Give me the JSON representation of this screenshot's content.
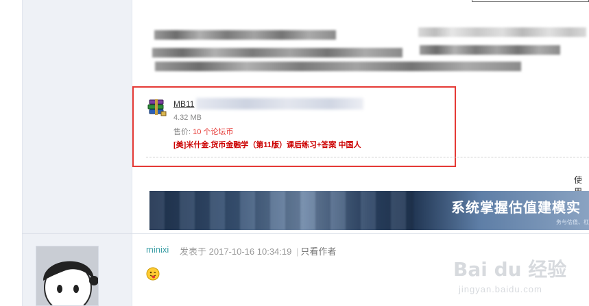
{
  "attachment": {
    "name_visible": "MB11",
    "size": "4.32 MB",
    "price_label": "售价: ",
    "price_value": "10 个论坛币",
    "title": "[美]米什金.货币金融学（第11版）课后练习+答案 中国人"
  },
  "side_text": {
    "use": "使用"
  },
  "banner": {
    "text": "系统掌握估值建模实",
    "subtext": "务与估值、杠"
  },
  "post": {
    "author": "minixi",
    "posted_prefix": "发表于",
    "timestamp": "2017-10-16 10:34:19",
    "separator": "|",
    "only_author": "只看作者"
  },
  "watermark": {
    "main": "Bai du 经验",
    "sub": "jingyan.baidu.com"
  },
  "colors": {
    "highlight_border": "#e53935",
    "author_link": "#3a9ea5",
    "attachment_title": "#cc0000"
  },
  "icons": {
    "attachment": "rar-archive-icon",
    "emoji": "tongue-smiley-icon"
  }
}
